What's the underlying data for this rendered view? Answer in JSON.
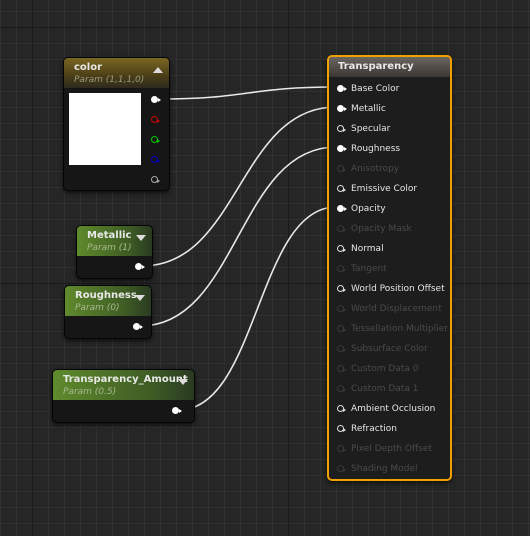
{
  "nodes": {
    "color": {
      "title": "color",
      "subtitle": "Param (1,1,1,0)",
      "preview_color": "#ffffff",
      "header_color": "#7a6620",
      "outputs": [
        {
          "channel": "RGB",
          "color": "#ffffff"
        },
        {
          "channel": "R",
          "color": "#cc0000"
        },
        {
          "channel": "G",
          "color": "#00cc00"
        },
        {
          "channel": "B",
          "color": "#0000cc"
        },
        {
          "channel": "A",
          "color": "#aaaaaa"
        }
      ]
    },
    "metallic": {
      "title": "Metallic",
      "subtitle": "Param (1)",
      "header_color": "#5f8a2c"
    },
    "roughness": {
      "title": "Roughness",
      "subtitle": "Param (0)",
      "header_color": "#5f8a2c"
    },
    "transparency_amount": {
      "title": "Transparency_Amount",
      "subtitle": "Param (0.5)",
      "header_color": "#5f8a2c"
    }
  },
  "material": {
    "title": "Transparency",
    "border_color": "#f0a000",
    "inputs": [
      {
        "label": "Base Color",
        "state": "connected"
      },
      {
        "label": "Metallic",
        "state": "connected"
      },
      {
        "label": "Specular",
        "state": "enabled"
      },
      {
        "label": "Roughness",
        "state": "connected"
      },
      {
        "label": "Anisotropy",
        "state": "disabled"
      },
      {
        "label": "Emissive Color",
        "state": "enabled"
      },
      {
        "label": "Opacity",
        "state": "connected"
      },
      {
        "label": "Opacity Mask",
        "state": "disabled"
      },
      {
        "label": "Normal",
        "state": "enabled"
      },
      {
        "label": "Tangent",
        "state": "disabled"
      },
      {
        "label": "World Position Offset",
        "state": "enabled"
      },
      {
        "label": "World Displacement",
        "state": "disabled"
      },
      {
        "label": "Tessellation Multiplier",
        "state": "disabled"
      },
      {
        "label": "Subsurface Color",
        "state": "disabled"
      },
      {
        "label": "Custom Data 0",
        "state": "disabled"
      },
      {
        "label": "Custom Data 1",
        "state": "disabled"
      },
      {
        "label": "Ambient Occlusion",
        "state": "enabled"
      },
      {
        "label": "Refraction",
        "state": "enabled"
      },
      {
        "label": "Pixel Depth Offset",
        "state": "disabled"
      },
      {
        "label": "Shading Model",
        "state": "disabled"
      }
    ]
  },
  "connections": [
    {
      "from": "color",
      "to": "Base Color"
    },
    {
      "from": "metallic",
      "to": "Metallic"
    },
    {
      "from": "roughness",
      "to": "Roughness"
    },
    {
      "from": "transparency_amount",
      "to": "Opacity"
    }
  ]
}
